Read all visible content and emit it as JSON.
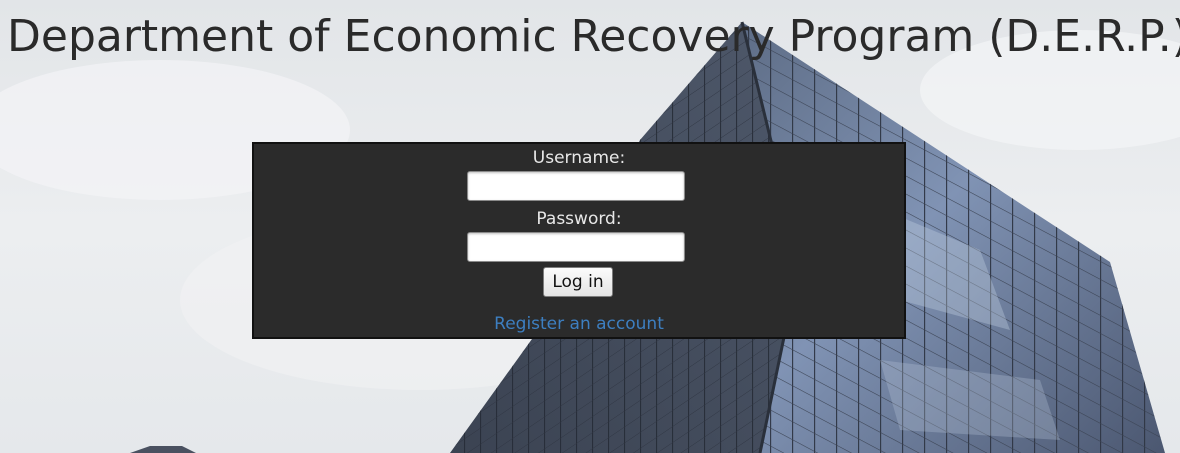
{
  "page": {
    "title": "Department of Economic Recovery Program (D.E.R.P.)"
  },
  "login": {
    "username_label": "Username:",
    "username_value": "",
    "password_label": "Password:",
    "password_value": "",
    "submit_label": "Log in",
    "register_link": "Register an account"
  },
  "colors": {
    "panel_background": "#2b2b2b",
    "label_text": "#e8e8e8",
    "link": "#3d7fc1",
    "title_text": "#2a2a2a"
  }
}
